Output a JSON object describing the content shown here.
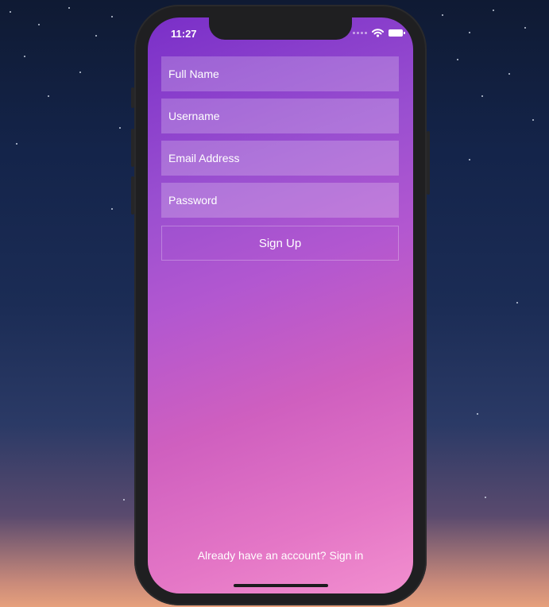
{
  "status_bar": {
    "time": "11:27",
    "wifi_icon": "wifi-icon",
    "battery_icon": "battery-icon"
  },
  "form": {
    "full_name": {
      "placeholder": "Full Name",
      "value": ""
    },
    "username": {
      "placeholder": "Username",
      "value": ""
    },
    "email": {
      "placeholder": "Email Address",
      "value": ""
    },
    "password": {
      "placeholder": "Password",
      "value": ""
    },
    "submit_label": "Sign Up"
  },
  "footer": {
    "signin_text": "Already have an account? Sign in"
  },
  "colors": {
    "gradient_top": "#7a2fc8",
    "gradient_bottom": "#f28fcf",
    "phone_frame": "#1f1f21"
  }
}
